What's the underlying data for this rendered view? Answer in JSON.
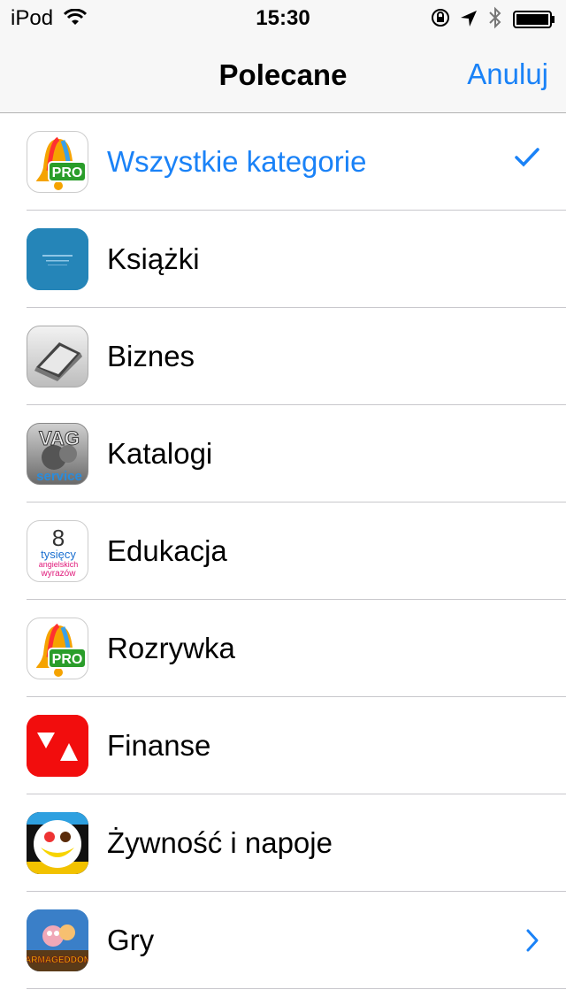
{
  "status_bar": {
    "carrier": "iPod",
    "time": "15:30",
    "icons": [
      "wifi-icon",
      "rotation-lock-icon",
      "location-arrow-icon",
      "bluetooth-icon",
      "battery-icon"
    ]
  },
  "nav": {
    "title": "Polecane",
    "cancel_label": "Anuluj"
  },
  "colors": {
    "accent": "#1a82f7",
    "separator": "#c8c7cc",
    "bar_background": "#f7f7f7"
  },
  "categories": [
    {
      "label": "Wszystkie kategorie",
      "icon": "bell-pro-app-icon",
      "icon_text": "PRO",
      "selected": true,
      "accessory": "checkmark-icon"
    },
    {
      "label": "Książki",
      "icon": "book-app-icon",
      "icon_text": "",
      "selected": false
    },
    {
      "label": "Biznes",
      "icon": "scanner-app-icon",
      "icon_text": "",
      "selected": false
    },
    {
      "label": "Katalogi",
      "icon": "vag-service-app-icon",
      "icon_text": "VAG service",
      "selected": false
    },
    {
      "label": "Edukacja",
      "icon": "tysiecy-app-icon",
      "icon_text": "8 tysięcy angielskich wyrazów",
      "selected": false
    },
    {
      "label": "Rozrywka",
      "icon": "bell-pro-app-icon",
      "icon_text": "PRO",
      "selected": false
    },
    {
      "label": "Finanse",
      "icon": "finance-triangle-app-icon",
      "icon_text": "",
      "selected": false
    },
    {
      "label": "Żywność i napoje",
      "icon": "food-plate-app-icon",
      "icon_text": "",
      "selected": false
    },
    {
      "label": "Gry",
      "icon": "worms-armageddon-app-icon",
      "icon_text": "ARMAGEDDON",
      "selected": false,
      "accessory": "chevron-right-icon"
    }
  ]
}
